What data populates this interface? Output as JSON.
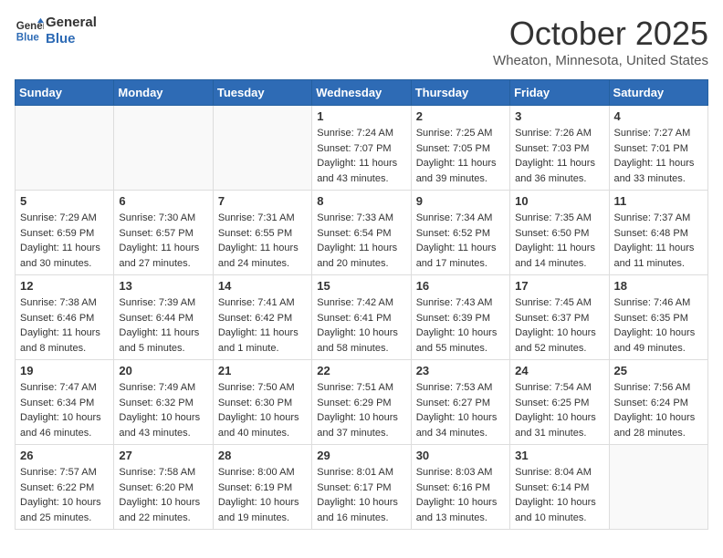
{
  "header": {
    "logo_line1": "General",
    "logo_line2": "Blue",
    "month_title": "October 2025",
    "location": "Wheaton, Minnesota, United States"
  },
  "weekdays": [
    "Sunday",
    "Monday",
    "Tuesday",
    "Wednesday",
    "Thursday",
    "Friday",
    "Saturday"
  ],
  "weeks": [
    [
      {
        "day": "",
        "info": ""
      },
      {
        "day": "",
        "info": ""
      },
      {
        "day": "",
        "info": ""
      },
      {
        "day": "1",
        "info": "Sunrise: 7:24 AM\nSunset: 7:07 PM\nDaylight: 11 hours\nand 43 minutes."
      },
      {
        "day": "2",
        "info": "Sunrise: 7:25 AM\nSunset: 7:05 PM\nDaylight: 11 hours\nand 39 minutes."
      },
      {
        "day": "3",
        "info": "Sunrise: 7:26 AM\nSunset: 7:03 PM\nDaylight: 11 hours\nand 36 minutes."
      },
      {
        "day": "4",
        "info": "Sunrise: 7:27 AM\nSunset: 7:01 PM\nDaylight: 11 hours\nand 33 minutes."
      }
    ],
    [
      {
        "day": "5",
        "info": "Sunrise: 7:29 AM\nSunset: 6:59 PM\nDaylight: 11 hours\nand 30 minutes."
      },
      {
        "day": "6",
        "info": "Sunrise: 7:30 AM\nSunset: 6:57 PM\nDaylight: 11 hours\nand 27 minutes."
      },
      {
        "day": "7",
        "info": "Sunrise: 7:31 AM\nSunset: 6:55 PM\nDaylight: 11 hours\nand 24 minutes."
      },
      {
        "day": "8",
        "info": "Sunrise: 7:33 AM\nSunset: 6:54 PM\nDaylight: 11 hours\nand 20 minutes."
      },
      {
        "day": "9",
        "info": "Sunrise: 7:34 AM\nSunset: 6:52 PM\nDaylight: 11 hours\nand 17 minutes."
      },
      {
        "day": "10",
        "info": "Sunrise: 7:35 AM\nSunset: 6:50 PM\nDaylight: 11 hours\nand 14 minutes."
      },
      {
        "day": "11",
        "info": "Sunrise: 7:37 AM\nSunset: 6:48 PM\nDaylight: 11 hours\nand 11 minutes."
      }
    ],
    [
      {
        "day": "12",
        "info": "Sunrise: 7:38 AM\nSunset: 6:46 PM\nDaylight: 11 hours\nand 8 minutes."
      },
      {
        "day": "13",
        "info": "Sunrise: 7:39 AM\nSunset: 6:44 PM\nDaylight: 11 hours\nand 5 minutes."
      },
      {
        "day": "14",
        "info": "Sunrise: 7:41 AM\nSunset: 6:42 PM\nDaylight: 11 hours\nand 1 minute."
      },
      {
        "day": "15",
        "info": "Sunrise: 7:42 AM\nSunset: 6:41 PM\nDaylight: 10 hours\nand 58 minutes."
      },
      {
        "day": "16",
        "info": "Sunrise: 7:43 AM\nSunset: 6:39 PM\nDaylight: 10 hours\nand 55 minutes."
      },
      {
        "day": "17",
        "info": "Sunrise: 7:45 AM\nSunset: 6:37 PM\nDaylight: 10 hours\nand 52 minutes."
      },
      {
        "day": "18",
        "info": "Sunrise: 7:46 AM\nSunset: 6:35 PM\nDaylight: 10 hours\nand 49 minutes."
      }
    ],
    [
      {
        "day": "19",
        "info": "Sunrise: 7:47 AM\nSunset: 6:34 PM\nDaylight: 10 hours\nand 46 minutes."
      },
      {
        "day": "20",
        "info": "Sunrise: 7:49 AM\nSunset: 6:32 PM\nDaylight: 10 hours\nand 43 minutes."
      },
      {
        "day": "21",
        "info": "Sunrise: 7:50 AM\nSunset: 6:30 PM\nDaylight: 10 hours\nand 40 minutes."
      },
      {
        "day": "22",
        "info": "Sunrise: 7:51 AM\nSunset: 6:29 PM\nDaylight: 10 hours\nand 37 minutes."
      },
      {
        "day": "23",
        "info": "Sunrise: 7:53 AM\nSunset: 6:27 PM\nDaylight: 10 hours\nand 34 minutes."
      },
      {
        "day": "24",
        "info": "Sunrise: 7:54 AM\nSunset: 6:25 PM\nDaylight: 10 hours\nand 31 minutes."
      },
      {
        "day": "25",
        "info": "Sunrise: 7:56 AM\nSunset: 6:24 PM\nDaylight: 10 hours\nand 28 minutes."
      }
    ],
    [
      {
        "day": "26",
        "info": "Sunrise: 7:57 AM\nSunset: 6:22 PM\nDaylight: 10 hours\nand 25 minutes."
      },
      {
        "day": "27",
        "info": "Sunrise: 7:58 AM\nSunset: 6:20 PM\nDaylight: 10 hours\nand 22 minutes."
      },
      {
        "day": "28",
        "info": "Sunrise: 8:00 AM\nSunset: 6:19 PM\nDaylight: 10 hours\nand 19 minutes."
      },
      {
        "day": "29",
        "info": "Sunrise: 8:01 AM\nSunset: 6:17 PM\nDaylight: 10 hours\nand 16 minutes."
      },
      {
        "day": "30",
        "info": "Sunrise: 8:03 AM\nSunset: 6:16 PM\nDaylight: 10 hours\nand 13 minutes."
      },
      {
        "day": "31",
        "info": "Sunrise: 8:04 AM\nSunset: 6:14 PM\nDaylight: 10 hours\nand 10 minutes."
      },
      {
        "day": "",
        "info": ""
      }
    ]
  ]
}
